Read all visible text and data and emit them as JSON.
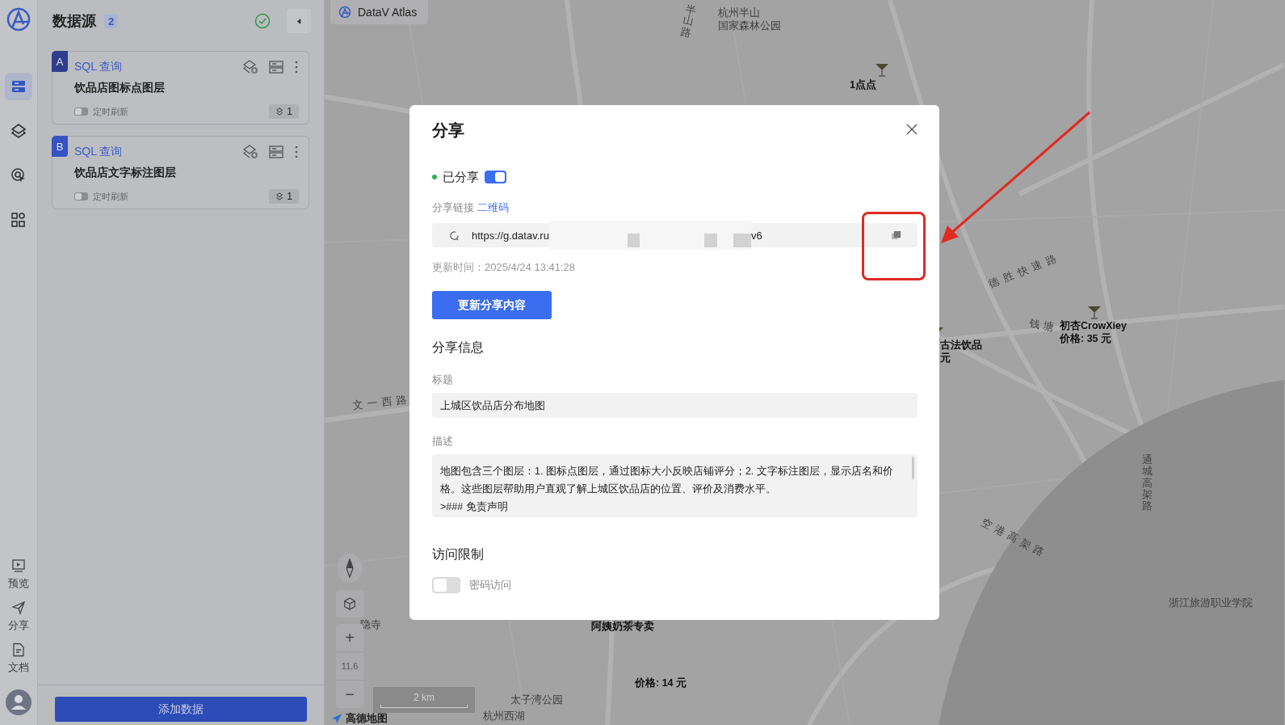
{
  "rail": {
    "top_items": [
      {
        "kind": "datasource",
        "selected": true
      },
      {
        "kind": "layers",
        "selected": false
      },
      {
        "kind": "analysis",
        "selected": false
      },
      {
        "kind": "widgets",
        "selected": false
      }
    ],
    "bottom_items": [
      {
        "kind": "preview",
        "label": "预览"
      },
      {
        "kind": "share",
        "label": "分享"
      },
      {
        "kind": "docs",
        "label": "文档"
      }
    ]
  },
  "panel": {
    "title": "数据源",
    "count": "2",
    "status_ok": true,
    "sources": [
      {
        "letter": "A",
        "color": "#2f3d8c",
        "type": "SQL 查询",
        "name": "饮品店图标点图层",
        "refresh_label": "定时刷新",
        "refresh_on": false,
        "layer_count": "1"
      },
      {
        "letter": "B",
        "color": "#3553c2",
        "type": "SQL 查询",
        "name": "饮品店文字标注图层",
        "refresh_label": "定时刷新",
        "refresh_on": false,
        "layer_count": "1"
      }
    ],
    "add_button": "添加数据"
  },
  "map": {
    "brand": "DataV Atlas",
    "labels": [
      {
        "kind": "place",
        "lines": [
          "杭州半山",
          "国家森林公园"
        ]
      },
      {
        "kind": "road",
        "lines": [
          "半山路"
        ]
      },
      {
        "kind": "poi",
        "lines": [
          "1点点"
        ]
      },
      {
        "kind": "road",
        "lines": [
          "德胜快速路"
        ]
      },
      {
        "kind": "road",
        "lines": [
          "钱塘"
        ]
      },
      {
        "kind": "poi",
        "lines": [
          "初杏CrowXiey",
          "价格: 35 元"
        ]
      },
      {
        "kind": "poi",
        "lines": [
          "古法饮品",
          "元"
        ]
      },
      {
        "kind": "road",
        "lines": [
          "文一西路"
        ]
      },
      {
        "kind": "road",
        "lines": [
          "通城高架路"
        ]
      },
      {
        "kind": "road",
        "lines": [
          "空港高架路"
        ]
      },
      {
        "kind": "place",
        "lines": [
          "浙江旅游职业学院"
        ]
      },
      {
        "kind": "place",
        "lines": [
          "隐寺"
        ]
      },
      {
        "kind": "poi",
        "lines": [
          "阿姨奶茶专卖"
        ]
      },
      {
        "kind": "poi",
        "lines": [
          "价格: 14 元"
        ]
      },
      {
        "kind": "place",
        "lines": [
          "太子湾公园"
        ]
      },
      {
        "kind": "place",
        "lines": [
          "杭州西湖"
        ]
      }
    ],
    "zoom_in": "+",
    "zoom_level": "11.6",
    "zoom_out": "−",
    "scale": "2 km",
    "provider": "高德地图"
  },
  "dialog": {
    "title": "分享",
    "shared_label": "已分享",
    "shared": true,
    "link_label": "分享链接",
    "qr_link": "二维码",
    "url_start": "https://g.datav.ru",
    "url_end": "v6",
    "updated": "更新时间：2025/4/24 13:41:28",
    "update_button": "更新分享内容",
    "info_heading": "分享信息",
    "title_label": "标题",
    "title_value": "上城区饮品店分布地图",
    "desc_label": "描述",
    "desc_value": "地图包含三个图层：1. 图标点图层，通过图标大小反映店铺评分；2. 文字标注图层，显示店名和价格。这些图层帮助用户直观了解上城区饮品店的位置、评价及消费水平。\n>### 免责声明",
    "access_heading": "访问限制",
    "password_label": "密码访问",
    "password_on": false
  }
}
